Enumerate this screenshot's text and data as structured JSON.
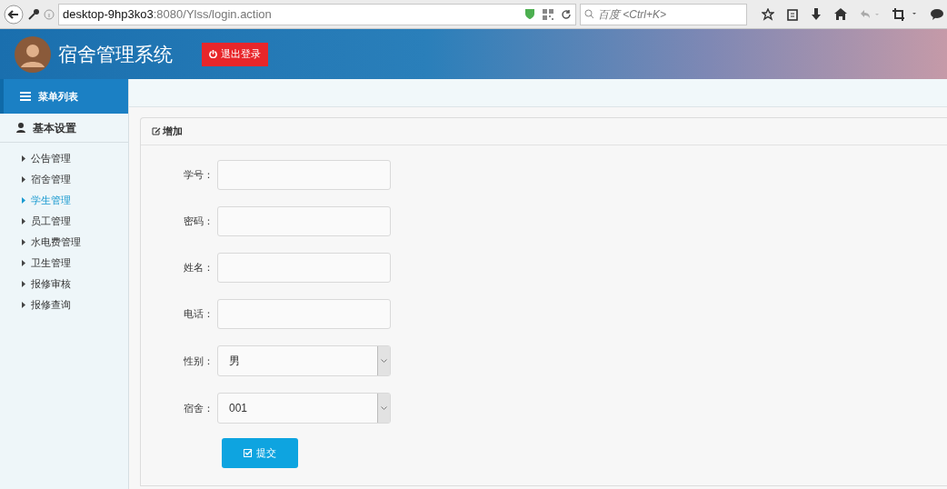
{
  "browser": {
    "url_host": "desktop-9hp3ko3",
    "url_path": ":8080/Ylss/login.action",
    "search_placeholder": "百度 <Ctrl+K>"
  },
  "header": {
    "title": "宿舍管理系统",
    "logout_button": "退出登录"
  },
  "sidebar": {
    "menu_title": "菜单列表",
    "section_title": "基本设置",
    "items": [
      {
        "label": "公告管理",
        "selected": false
      },
      {
        "label": "宿舍管理",
        "selected": false
      },
      {
        "label": "学生管理",
        "selected": true
      },
      {
        "label": "员工管理",
        "selected": false
      },
      {
        "label": "水电费管理",
        "selected": false
      },
      {
        "label": "卫生管理",
        "selected": false
      },
      {
        "label": "报修审核",
        "selected": false
      },
      {
        "label": "报修查询",
        "selected": false
      }
    ]
  },
  "form": {
    "title": "增加",
    "fields": [
      {
        "kind": "text",
        "label": "学号："
      },
      {
        "kind": "text",
        "label": "密码："
      },
      {
        "kind": "text",
        "label": "姓名："
      },
      {
        "kind": "text",
        "label": "电话："
      },
      {
        "kind": "select",
        "label": "性别：",
        "value": "男"
      },
      {
        "kind": "select",
        "label": "宿舍：",
        "value": "001"
      }
    ],
    "submit_button": "提交"
  }
}
